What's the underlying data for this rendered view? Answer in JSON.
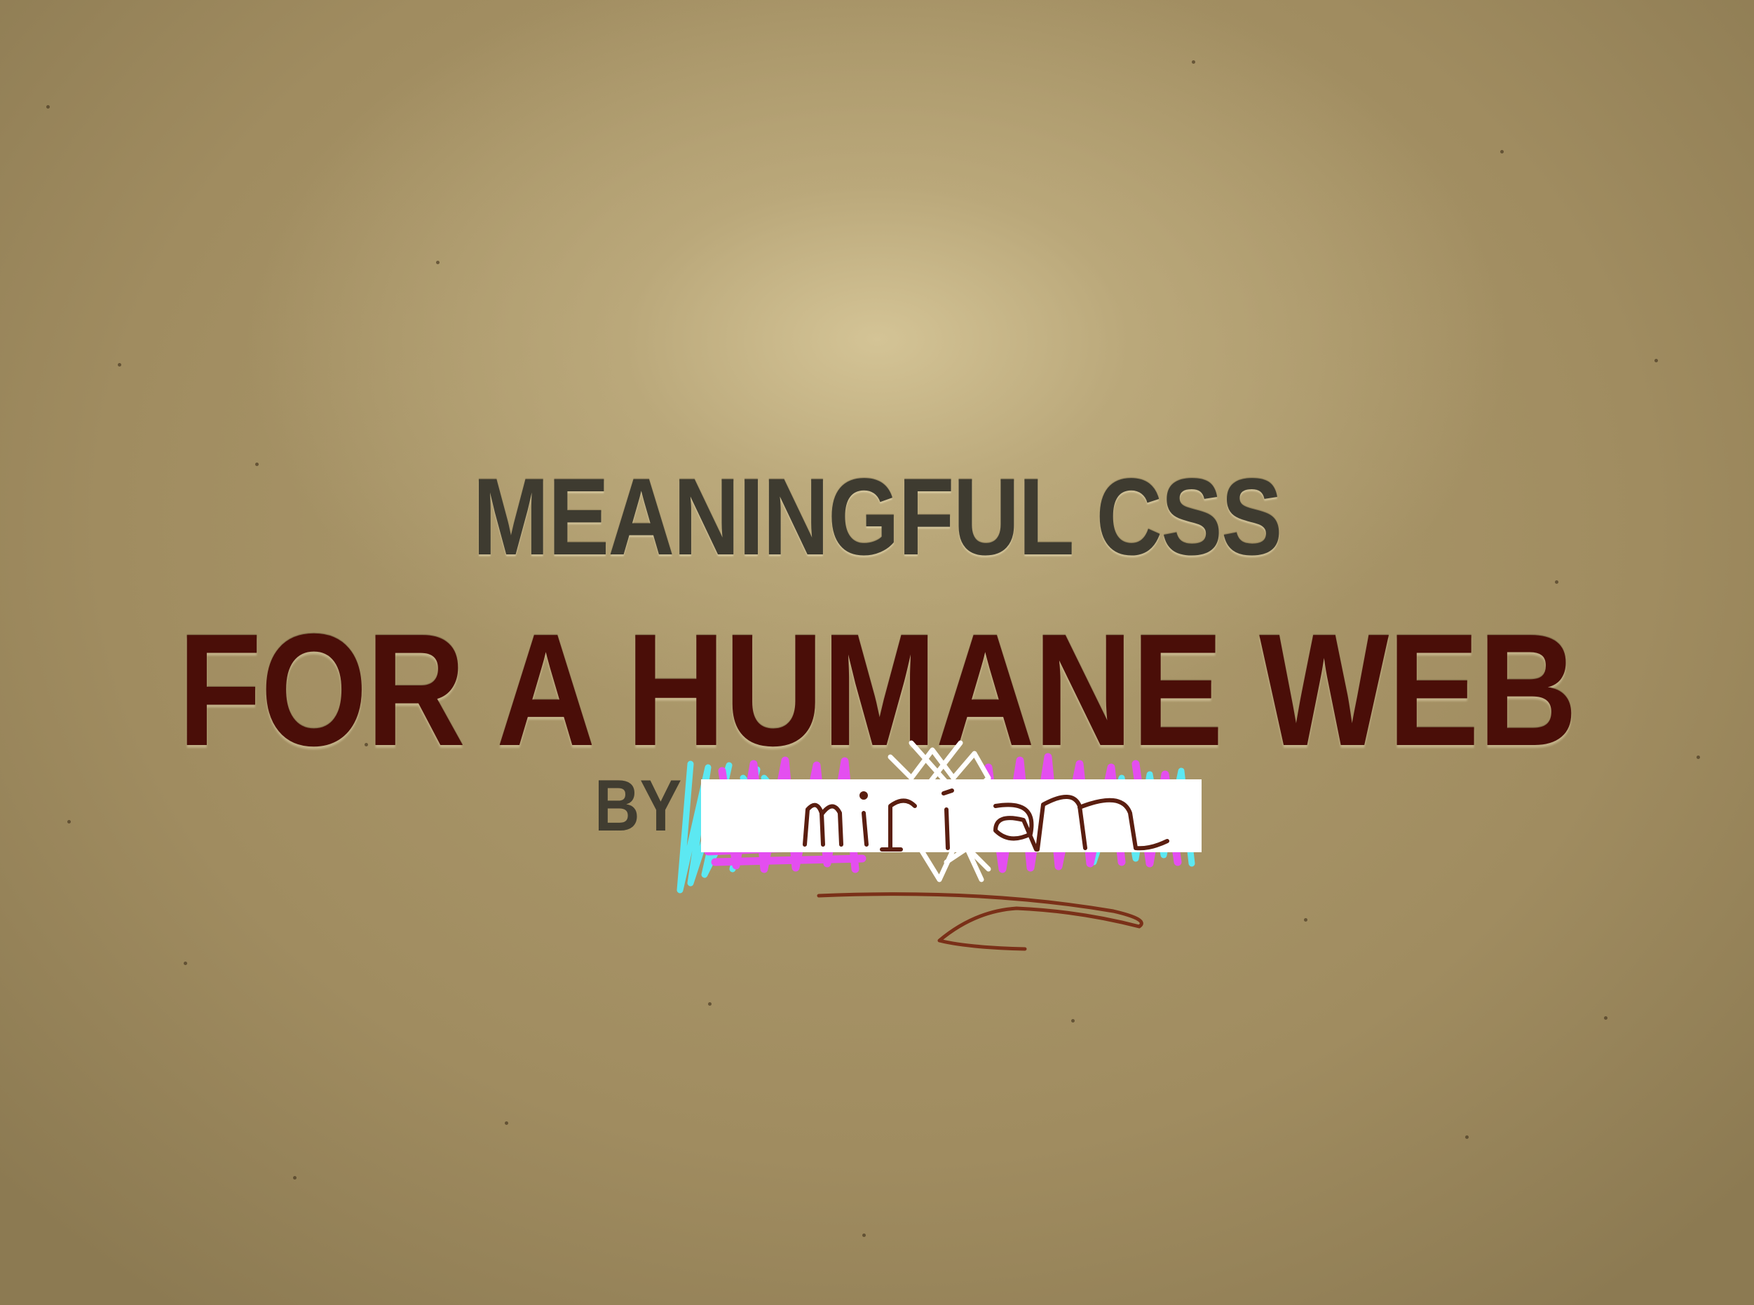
{
  "slide": {
    "title_line1": "MEANINGFUL CSS",
    "title_line2": "FOR A HUMANE WEB",
    "byline_prefix": "BY",
    "author_handwritten": "miriam"
  },
  "colors": {
    "background": "#a8966a",
    "title_line1": "#3e3b30",
    "title_line2": "#4a0e08",
    "byline": "#413d31",
    "handwriting": "#5a1e10",
    "scribble_cyan": "#5ce8f2",
    "scribble_magenta": "#e44ef0"
  }
}
